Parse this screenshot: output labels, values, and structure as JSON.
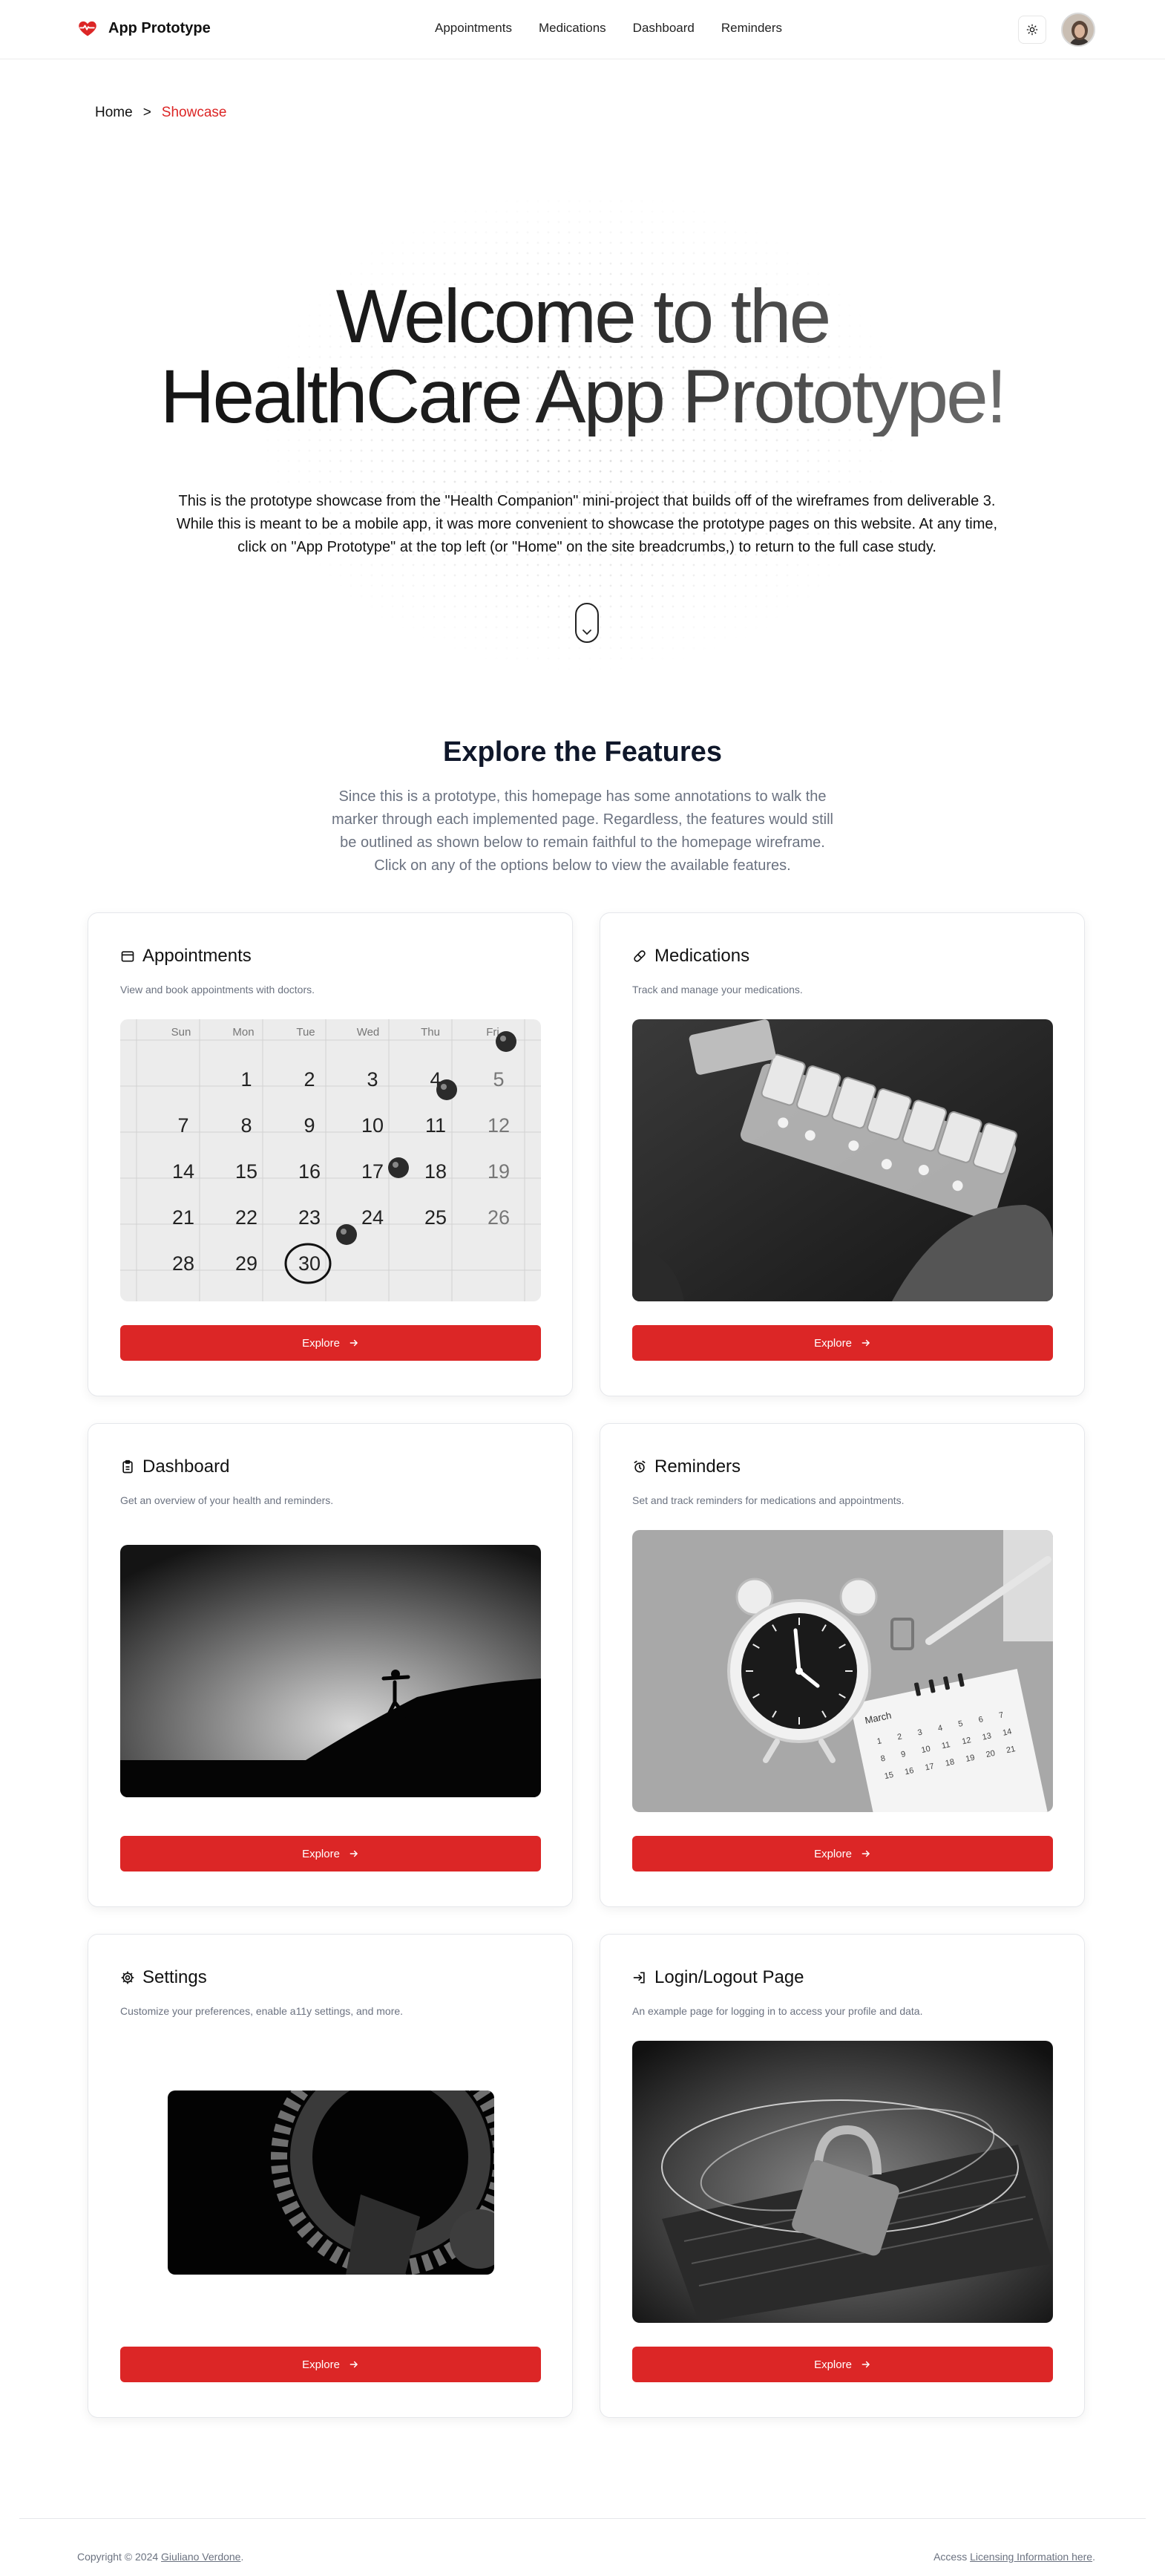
{
  "brand": {
    "title": "App Prototype",
    "icon": "heart-pulse-icon",
    "color": "#dc2626"
  },
  "nav": [
    "Appointments",
    "Medications",
    "Dashboard",
    "Reminders"
  ],
  "header": {
    "theme_icon": "sun-icon"
  },
  "breadcrumb": {
    "home": "Home",
    "separator": ">",
    "current": "Showcase"
  },
  "hero": {
    "title_line1": "Welcome to the",
    "title_line2": "HealthCare App Prototype!",
    "description": "This is the prototype showcase from the \"Health Companion\" mini-project that builds off of the wireframes from deliverable 3. While this is meant to be a mobile app, it was more convenient to showcase the prototype pages on this website. At any time, click on \"App Prototype\" at the top left (or \"Home\" on the site breadcrumbs,) to return to the full case study."
  },
  "features": {
    "title": "Explore the Features",
    "description": "Since this is a prototype, this homepage has some annotations to walk the marker through each implemented page. Regardless, the features would still be outlined as shown below to remain faithful to the homepage wireframe. Click on any of the options below to view the available features.",
    "explore_label": "Explore",
    "cards": [
      {
        "title": "Appointments",
        "description": "View and book appointments with doctors.",
        "icon": "calendar-icon"
      },
      {
        "title": "Medications",
        "description": "Track and manage your medications.",
        "icon": "pill-icon"
      },
      {
        "title": "Dashboard",
        "description": "Get an overview of your health and reminders.",
        "icon": "clipboard-icon"
      },
      {
        "title": "Reminders",
        "description": "Set and track reminders for medications and appointments.",
        "icon": "alarm-clock-icon"
      },
      {
        "title": "Settings",
        "description": "Customize your preferences, enable a11y settings, and more.",
        "icon": "gear-icon"
      },
      {
        "title": "Login/Logout Page",
        "description": "An example page for logging in to access your profile and data.",
        "icon": "login-icon"
      }
    ]
  },
  "calendar": {
    "days": [
      "Sun",
      "Mon",
      "Tue",
      "Wed",
      "Thu",
      "Fri"
    ],
    "rows": [
      [
        "",
        "1",
        "2",
        "3",
        "4",
        "5"
      ],
      [
        "7",
        "8",
        "9",
        "10",
        "11",
        "12"
      ],
      [
        "14",
        "15",
        "16",
        "17",
        "18",
        "19"
      ],
      [
        "21",
        "22",
        "23",
        "24",
        "25",
        "26"
      ],
      [
        "28",
        "29",
        "30",
        "",
        "",
        ""
      ]
    ]
  },
  "reminder_calendar": {
    "month": "March",
    "numbers": [
      "1",
      "2",
      "3",
      "4",
      "5",
      "6",
      "7",
      "8",
      "9",
      "10",
      "11",
      "12",
      "13",
      "14",
      "15",
      "16",
      "17",
      "18",
      "19",
      "20",
      "21"
    ]
  },
  "footer": {
    "copyright_prefix": "Copyright © 2024",
    "author": "Giuliano Verdone",
    "access_prefix": "Access",
    "licensing_link": "Licensing Information here"
  }
}
